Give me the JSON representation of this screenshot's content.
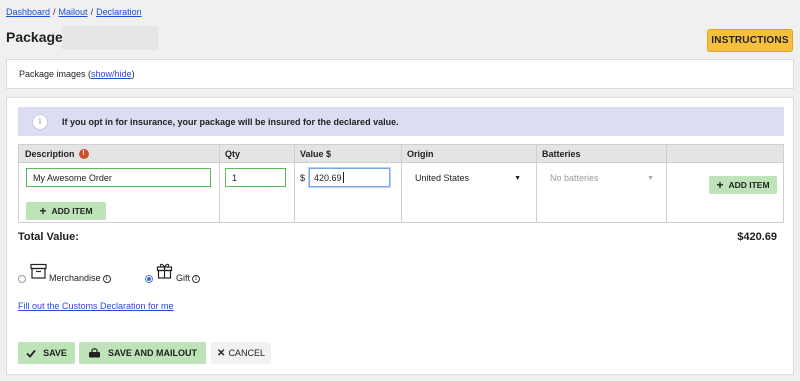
{
  "breadcrumb": [
    "Dashboard",
    "Mailout",
    "Declaration"
  ],
  "page": {
    "title": "Package",
    "instructions_label": "INSTRUCTIONS"
  },
  "images": {
    "label": "Package images",
    "toggle_link": "show/hide"
  },
  "info": {
    "message": "If you opt in for insurance, your package will be insured for the declared value."
  },
  "table": {
    "headers": {
      "description": "Description",
      "qty": "Qty",
      "value": "Value $",
      "origin": "Origin",
      "batteries": "Batteries"
    },
    "row": {
      "description": "My Awesome Order",
      "qty": "1",
      "currency": "$",
      "value": "420.69",
      "origin": "United States",
      "batteries_placeholder": "No batteries"
    },
    "add_item_label": "ADD ITEM",
    "add_item_row_label": "ADD ITEM"
  },
  "total": {
    "label": "Total Value:",
    "value": "$420.69"
  },
  "options": {
    "merchandise": "Merchandise",
    "gift": "Gift",
    "selected": "gift"
  },
  "customs_link": "Fill out the Customs Declaration for me",
  "actions": {
    "save": "SAVE",
    "save_mailout": "SAVE AND MAILOUT",
    "cancel": "CANCEL"
  },
  "colors": {
    "accent_yellow": "#f6c03d",
    "button_green": "#bfe3b8",
    "link_blue": "#1a4fd6",
    "info_bg": "#dcdcf2"
  }
}
